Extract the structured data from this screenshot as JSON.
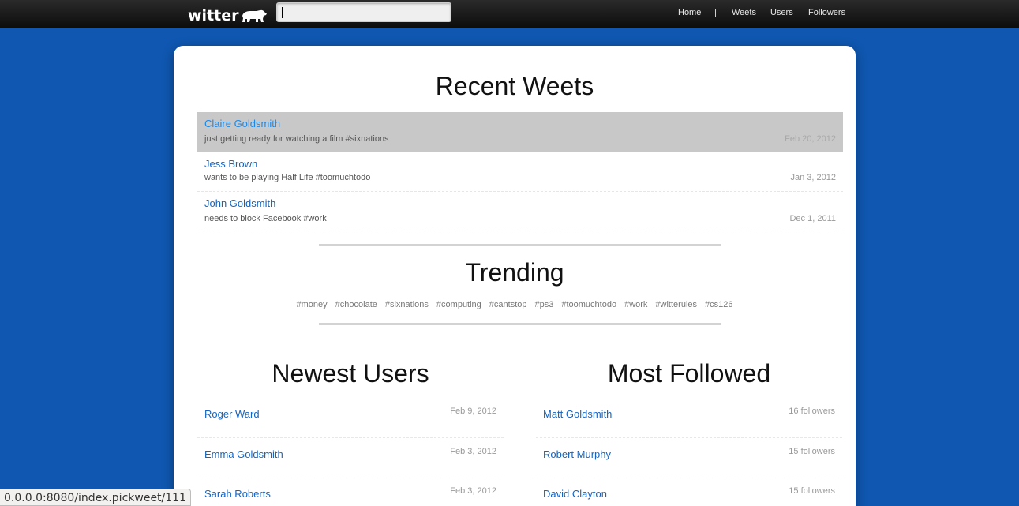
{
  "header": {
    "logo_text": "witter",
    "search": {
      "value": "",
      "placeholder": ""
    },
    "nav": [
      "Home",
      "|",
      "Weets",
      "Users",
      "Followers"
    ]
  },
  "recent_weets": {
    "title": "Recent Weets",
    "items": [
      {
        "author": "Claire Goldsmith",
        "message": "just getting ready for watching a film #sixnations",
        "date": "Feb 20, 2012"
      },
      {
        "author": "Jess Brown",
        "message": "wants to be playing Half Life #toomuchtodo",
        "date": "Jan 3, 2012"
      },
      {
        "author": "John Goldsmith",
        "message": "needs to block Facebook #work",
        "date": "Dec 1, 2011"
      }
    ]
  },
  "trending": {
    "title": "Trending",
    "tags": [
      "#money",
      "#chocolate",
      "#sixnations",
      "#computing",
      "#cantstop",
      "#ps3",
      "#toomuchtodo",
      "#work",
      "#witterules",
      "#cs126"
    ]
  },
  "newest_users": {
    "title": "Newest Users",
    "items": [
      {
        "name": "Roger Ward",
        "date": "Feb 9, 2012"
      },
      {
        "name": "Emma Goldsmith",
        "date": "Feb 3, 2012"
      },
      {
        "name": "Sarah Roberts",
        "date": "Feb 3, 2012"
      }
    ]
  },
  "most_followed": {
    "title": "Most Followed",
    "items": [
      {
        "name": "Matt Goldsmith",
        "followers": "16 followers"
      },
      {
        "name": "Robert Murphy",
        "followers": "15 followers"
      },
      {
        "name": "David Clayton",
        "followers": "15 followers"
      }
    ]
  },
  "statusbar": {
    "url": "0.0.0.0:8080/index.pickweet/111"
  },
  "colors": {
    "background": "#0f57b0",
    "link": "#1565c0",
    "highlight_row": "#c8c8c8"
  }
}
